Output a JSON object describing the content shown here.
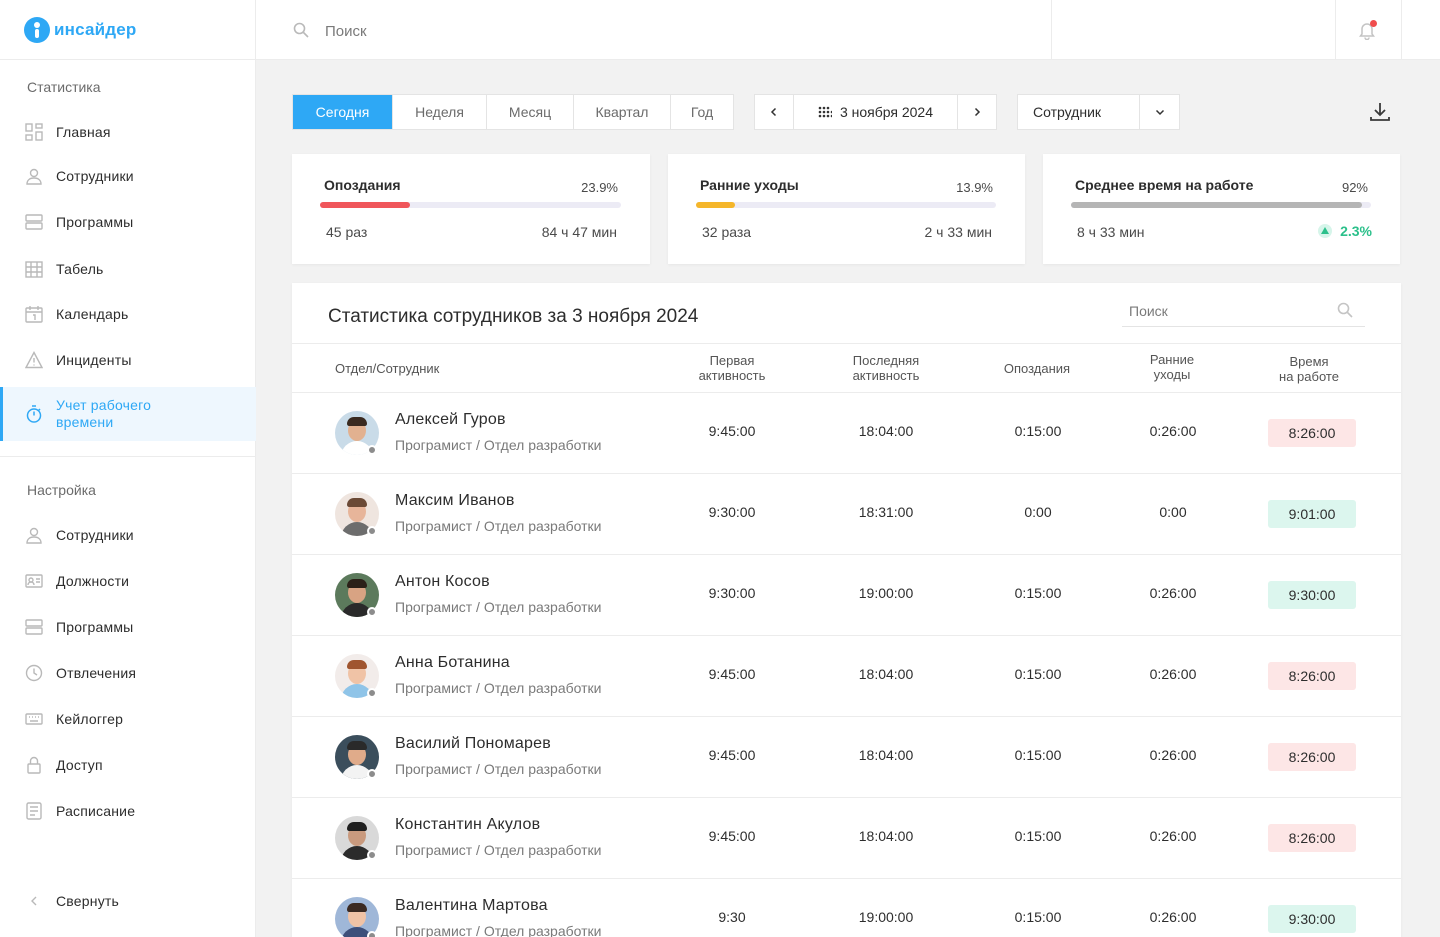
{
  "app": {
    "logo_text": "инсайдер"
  },
  "sidebar": {
    "stats_title": "Статистика",
    "stats_items": [
      {
        "label": "Главная",
        "icon": "dashboard-icon"
      },
      {
        "label": "Сотрудники",
        "icon": "user-icon"
      },
      {
        "label": "Программы",
        "icon": "programs-icon"
      },
      {
        "label": "Табель",
        "icon": "table-icon"
      },
      {
        "label": "Календарь",
        "icon": "calendar-icon"
      },
      {
        "label": "Инциденты",
        "icon": "warning-icon"
      },
      {
        "label": "Учет рабочего времени",
        "icon": "stopwatch-icon",
        "active": true
      }
    ],
    "settings_title": "Настройка",
    "settings_items": [
      {
        "label": "Сотрудники",
        "icon": "user-icon"
      },
      {
        "label": "Должности",
        "icon": "id-card-icon"
      },
      {
        "label": "Программы",
        "icon": "programs-icon"
      },
      {
        "label": "Отвлечения",
        "icon": "clock-icon"
      },
      {
        "label": "Кейлоггер",
        "icon": "keyboard-icon"
      },
      {
        "label": "Доступ",
        "icon": "lock-icon"
      },
      {
        "label": "Расписание",
        "icon": "schedule-icon"
      }
    ],
    "collapse_label": "Свернуть"
  },
  "topbar": {
    "search_placeholder": "Поиск"
  },
  "toolbar": {
    "periods": [
      "Сегодня",
      "Неделя",
      "Месяц",
      "Квартал",
      "Год"
    ],
    "active_period": "Сегодня",
    "date": "3 ноября 2024",
    "employee_select": "Сотрудник"
  },
  "cards": [
    {
      "title": "Опоздания",
      "percent": "23.9%",
      "fill": 0.3,
      "color": "#f0565b",
      "left": "45 раз",
      "right": "84 ч 47 мин"
    },
    {
      "title": "Ранние уходы",
      "percent": "13.9%",
      "fill": 0.13,
      "color": "#f5b62a",
      "left": "32 раза",
      "right": "2 ч 33 мин"
    },
    {
      "title": "Среднее время на работе",
      "percent": "92%",
      "fill": 0.97,
      "color": "#b5b5b5",
      "left": "8 ч 33 мин",
      "change": "2.3%"
    }
  ],
  "table": {
    "title": "Статистика сотрудников за 3 ноября 2024",
    "search_placeholder": "Поиск",
    "headers": {
      "employee": "Отдел/Сотрудник",
      "first": [
        "Первая",
        "активность"
      ],
      "last": [
        "Последняя",
        "активность"
      ],
      "late": "Опоздания",
      "early": [
        "Ранние",
        "уходы"
      ],
      "worktime": [
        "Время",
        "на работе"
      ]
    },
    "rows": [
      {
        "name": "Алексей Гуров",
        "role": "Програмист / Отдел разработки",
        "first": "9:45:00",
        "last": "18:04:00",
        "late": "0:15:00",
        "early": "0:26:00",
        "work": "8:26:00",
        "status": "red",
        "bg": "#c9dbe8",
        "skin": "#e2b190",
        "hair": "#3a2a20",
        "shirt": "#ffffff"
      },
      {
        "name": "Максим Иванов",
        "role": "Програмист / Отдел разработки",
        "first": "9:30:00",
        "last": "18:31:00",
        "late": "0:00",
        "early": "0:00",
        "work": "9:01:00",
        "status": "green",
        "bg": "#efe5df",
        "skin": "#e7b59a",
        "hair": "#6b4a36",
        "shirt": "#6d6d6d"
      },
      {
        "name": "Антон Косов",
        "role": "Програмист / Отдел разработки",
        "first": "9:30:00",
        "last": "19:00:00",
        "late": "0:15:00",
        "early": "0:26:00",
        "work": "9:30:00",
        "status": "green",
        "bg": "#5c7a5c",
        "skin": "#d8a383",
        "hair": "#2b2018",
        "shirt": "#2a2a2a"
      },
      {
        "name": "Анна Ботанина",
        "role": "Програмист / Отдел разработки",
        "first": "9:45:00",
        "last": "18:04:00",
        "late": "0:15:00",
        "early": "0:26:00",
        "work": "8:26:00",
        "status": "red",
        "bg": "#f2ecea",
        "skin": "#f0c3a6",
        "hair": "#a0552f",
        "shirt": "#8fc4e8"
      },
      {
        "name": "Василий Пономарев",
        "role": "Програмист / Отдел разработки",
        "first": "9:45:00",
        "last": "18:04:00",
        "late": "0:15:00",
        "early": "0:26:00",
        "work": "8:26:00",
        "status": "red",
        "bg": "#3b4e5c",
        "skin": "#e0ab8a",
        "hair": "#2a2a2a",
        "shirt": "#f3f3f3"
      },
      {
        "name": "Константин Акулов",
        "role": "Програмист / Отдел разработки",
        "first": "9:45:00",
        "last": "18:04:00",
        "late": "0:15:00",
        "early": "0:26:00",
        "work": "8:26:00",
        "status": "red",
        "bg": "#d9d9d9",
        "skin": "#c99a7e",
        "hair": "#1f1f1f",
        "shirt": "#2b2b2b"
      },
      {
        "name": "Валентина Мартова",
        "role": "Програмист / Отдел разработки",
        "first": "9:30",
        "last": "19:00:00",
        "late": "0:15:00",
        "early": "0:26:00",
        "work": "9:30:00",
        "status": "green",
        "bg": "#9fb7d8",
        "skin": "#f0c3a6",
        "hair": "#3b2a22",
        "shirt": "#3d4f7a"
      }
    ]
  }
}
